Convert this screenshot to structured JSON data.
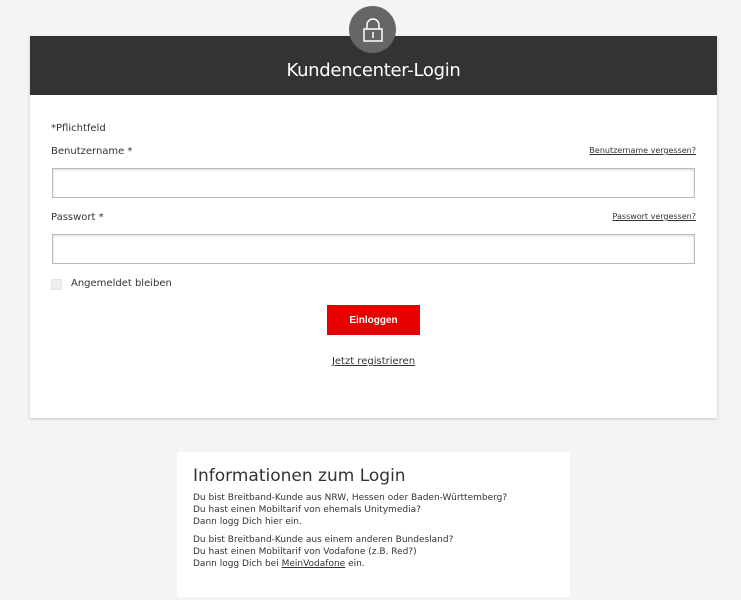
{
  "login": {
    "title": "Kundencenter-Login",
    "required_note": "*Pflichtfeld",
    "username_label": "Benutzername *",
    "username_forgot": "Benutzername vergessen?",
    "username_value": "",
    "password_label": "Passwort *",
    "password_forgot": "Passwort vergessen?",
    "password_value": "",
    "remember_label": "Angemeldet bleiben",
    "submit_label": "Einloggen",
    "register_label": "Jetzt registrieren"
  },
  "info": {
    "title": "Informationen zum Login",
    "p1": [
      "Du bist Breitband-Kunde aus NRW, Hessen oder Baden-Württemberg?",
      "Du hast einen Mobiltarif von ehemals Unitymedia?",
      "Dann logg Dich hier ein."
    ],
    "p2": [
      "Du bist Breitband-Kunde aus einem anderen Bundesland?",
      "Du hast einen Mobiltarif von Vodafone (z.B. Red?)"
    ],
    "p2_last_prefix": "Dann logg Dich bei ",
    "p2_link": "MeinVodafone",
    "p2_last_suffix": " ein."
  },
  "colors": {
    "accent": "#e60000",
    "header": "#333333"
  }
}
